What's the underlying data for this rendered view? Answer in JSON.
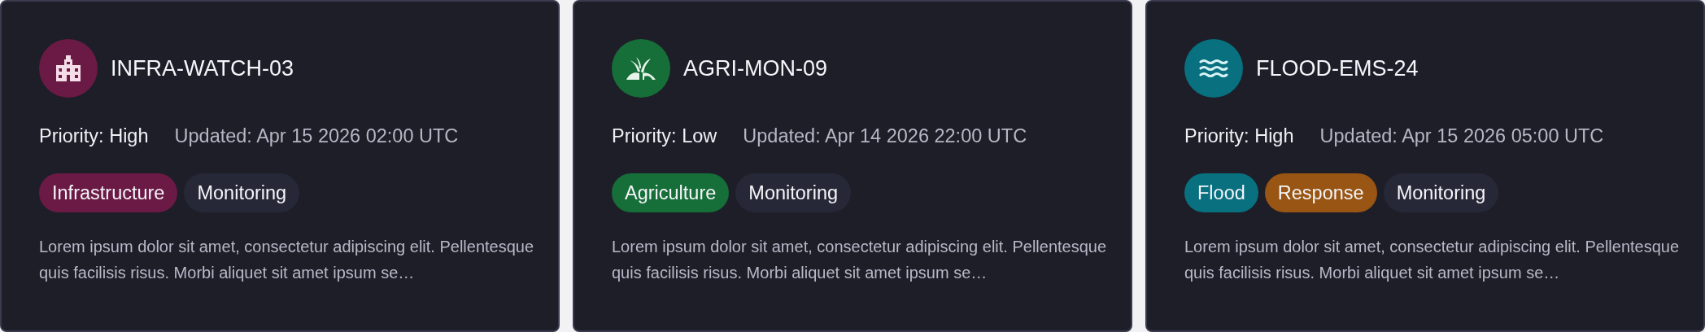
{
  "cards": [
    {
      "kind": "building",
      "color": "#6b1a45",
      "title": "INFRA-WATCH-03",
      "priority": "Priority: High",
      "updated": "Updated: Apr 15 2026 02:00 UTC",
      "tags": [
        {
          "label": "Infrastructure",
          "color": "#6b1a45"
        },
        {
          "label": "Monitoring",
          "color": "#262837"
        }
      ],
      "description": "Lorem ipsum dolor sit amet, consectetur adipiscing elit. Pellentesque quis facilisis risus. Morbi aliquet sit amet ipsum se…"
    },
    {
      "kind": "sprout",
      "color": "#166e38",
      "title": "AGRI-MON-09",
      "priority": "Priority: Low",
      "updated": "Updated: Apr 14 2026 22:00 UTC",
      "tags": [
        {
          "label": "Agriculture",
          "color": "#166e38"
        },
        {
          "label": "Monitoring",
          "color": "#262837"
        }
      ],
      "description": "Lorem ipsum dolor sit amet, consectetur adipiscing elit. Pellentesque quis facilisis risus. Morbi aliquet sit amet ipsum se…"
    },
    {
      "kind": "waves",
      "color": "#08707f",
      "title": "FLOOD-EMS-24",
      "priority": "Priority: High",
      "updated": "Updated: Apr 15 2026 05:00 UTC",
      "tags": [
        {
          "label": "Flood",
          "color": "#08707f"
        },
        {
          "label": "Response",
          "color": "#985513"
        },
        {
          "label": "Monitoring",
          "color": "#262837"
        }
      ],
      "description": "Lorem ipsum dolor sit amet, consectetur adipiscing elit. Pellentesque quis facilisis risus. Morbi aliquet sit amet ipsum se…"
    }
  ]
}
